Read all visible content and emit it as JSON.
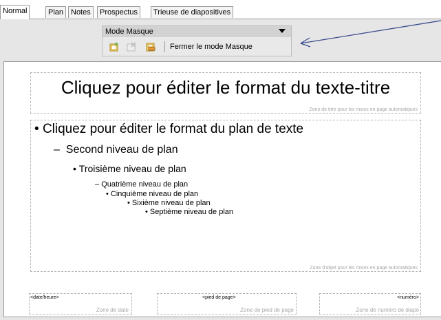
{
  "tabs": [
    "Normal",
    "Plan",
    "Notes",
    "Prospectus",
    "Trieuse de diapositives"
  ],
  "master_toolbar": {
    "title": "Mode Masque",
    "close_label": "Fermer le mode Masque",
    "icons": [
      "new-master-icon",
      "delete-master-icon",
      "rename-master-icon"
    ]
  },
  "slide": {
    "title_text": "Cliquez pour éditer le format du texte-titre",
    "title_zone_label": "Zone de titre pour les mises en page automatiques",
    "outline": [
      "Cliquez pour éditer le format du plan de texte",
      "Second niveau de plan",
      "Troisième niveau de plan",
      "Quatrième niveau de plan",
      "Cinquième niveau de plan",
      "Sixième niveau de plan",
      "Septième niveau de plan"
    ],
    "object_zone_label": "Zone d'objet pour les mises en page automatiques",
    "footer": {
      "date_field": "<date/heure>",
      "date_zone": "Zone de date",
      "footer_field": "<pied de page>",
      "footer_zone": "Zone de pied de page",
      "number_field": "<numéro>",
      "number_zone": "Zone de numéro de diapo"
    }
  },
  "colors": {
    "arrow": "#3a4a8c",
    "workspace": "#e6e6e6",
    "placeholder_border": "#b5b5b5"
  }
}
